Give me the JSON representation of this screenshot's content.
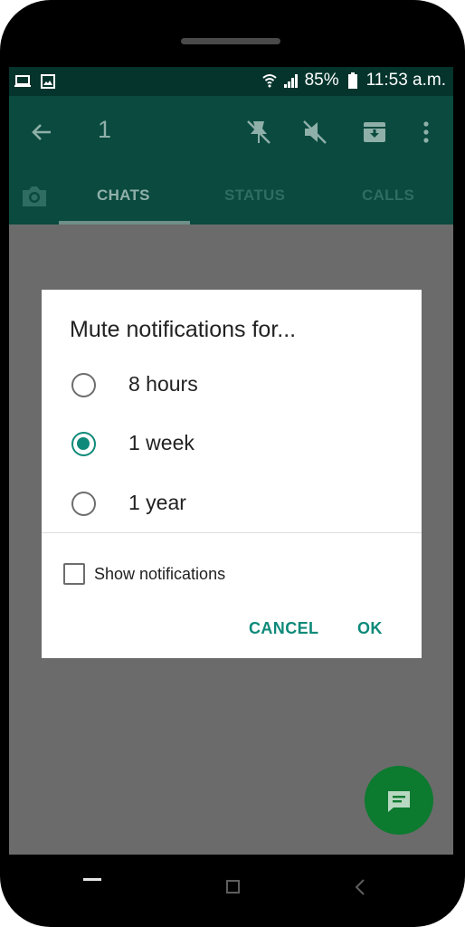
{
  "statusbar": {
    "battery": "85%",
    "time": "11:53 a.m.",
    "left_icons": [
      "laptop-icon",
      "image-icon"
    ],
    "right_icons": [
      "wifi-icon",
      "signal-icon",
      "battery-icon"
    ]
  },
  "toolbar": {
    "selected_count": "1",
    "icons": [
      "back-arrow-icon",
      "unpin-icon",
      "unmute-icon",
      "archive-icon",
      "more-vert-icon"
    ]
  },
  "tabs": {
    "camera_icon": "camera-icon",
    "items": [
      "CHATS",
      "STATUS",
      "CALLS"
    ],
    "active": "CHATS"
  },
  "dialog": {
    "title": "Mute notifications for...",
    "options": [
      {
        "label": "8 hours",
        "selected": false
      },
      {
        "label": "1 week",
        "selected": true
      },
      {
        "label": "1 year",
        "selected": false
      }
    ],
    "checkbox": {
      "label": "Show notifications",
      "checked": false
    },
    "buttons": {
      "cancel": "CANCEL",
      "ok": "OK"
    }
  },
  "fab": {
    "icon": "new-chat-icon"
  },
  "colors": {
    "accent": "#0f8a7a",
    "toolbar": "#0a4a3f",
    "statusbar": "#04342c",
    "fab": "#0c7a2f",
    "scrim": "#6b6b6b"
  }
}
